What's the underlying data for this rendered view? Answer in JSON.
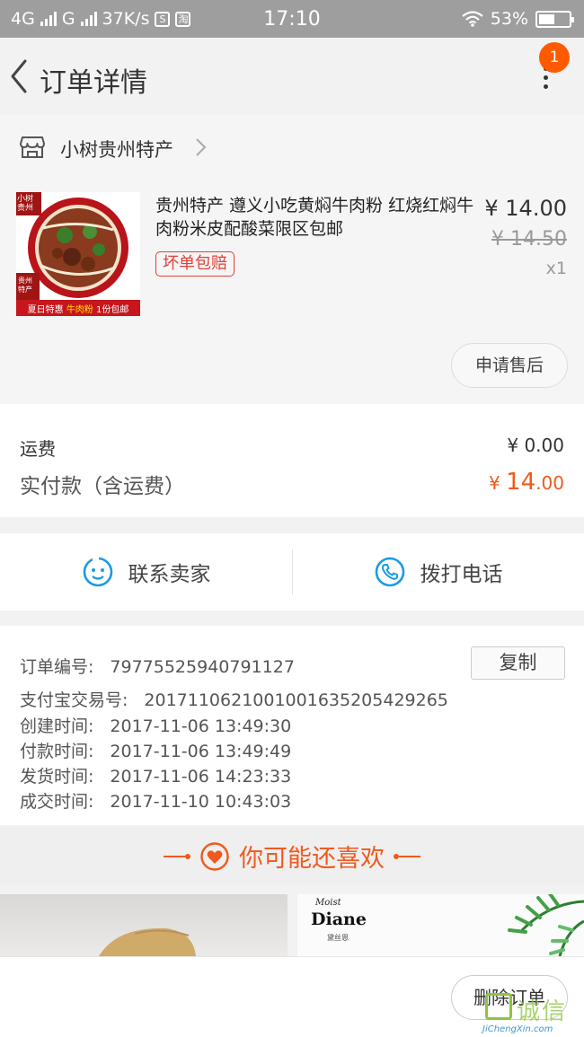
{
  "status_bar": {
    "network1": "4G",
    "network2": "G",
    "speed": "37K/s",
    "icon1": "S",
    "icon2": "淘",
    "time": "17:10",
    "battery": "53%",
    "battery_level": 0.53
  },
  "nav": {
    "title": "订单详情",
    "badge_count": "1"
  },
  "store": {
    "name": "小树贵州特产"
  },
  "product": {
    "title": "贵州特产 遵义小吃黄焖牛肉粉 红烧红焖牛肉粉米皮配酸菜限区包邮",
    "tag": "坏单包赔",
    "price": "¥ 14.00",
    "original_price": "¥ 14.50",
    "quantity": "x1",
    "thumb_brand": "小树贵州",
    "thumb_badge": "贵州特产",
    "thumb_banner_a": "夏日特惠",
    "thumb_banner_b": "牛肉粉",
    "thumb_banner_c": "1份包邮",
    "after_sale_button": "申请售后"
  },
  "fees": {
    "shipping_label": "运费",
    "shipping_value": "¥ 0.00",
    "paid_label": "实付款（含运费）",
    "paid_symbol": "¥ ",
    "paid_int": "14",
    "paid_dec": ".00"
  },
  "contact": {
    "seller": "联系卖家",
    "phone": "拨打电话"
  },
  "order_info": {
    "copy_button": "复制",
    "rows": [
      {
        "label": "订单编号:",
        "value": "79775525940791127"
      },
      {
        "label": "支付宝交易号:",
        "value": "2017110621001001635205429265"
      },
      {
        "label": "创建时间:",
        "value": "2017-11-06 13:49:30"
      },
      {
        "label": "付款时间:",
        "value": "2017-11-06 13:49:49"
      },
      {
        "label": "发货时间:",
        "value": "2017-11-06 14:23:33"
      },
      {
        "label": "成交时间:",
        "value": "2017-11-10 10:43:03"
      }
    ]
  },
  "recommend": {
    "title": "你可能还喜欢",
    "brand_script": "Moist",
    "brand_name": "Diane",
    "brand_cn": "黛丝恩"
  },
  "bottom": {
    "delete_button": "删除订单"
  },
  "watermark": {
    "cn": "诚信",
    "url": "JiChengXin.com"
  },
  "colors": {
    "accent": "#f05a1e",
    "badge": "#ff5a00",
    "icon_blue": "#1a9be6",
    "tag_red": "#e0403a"
  }
}
